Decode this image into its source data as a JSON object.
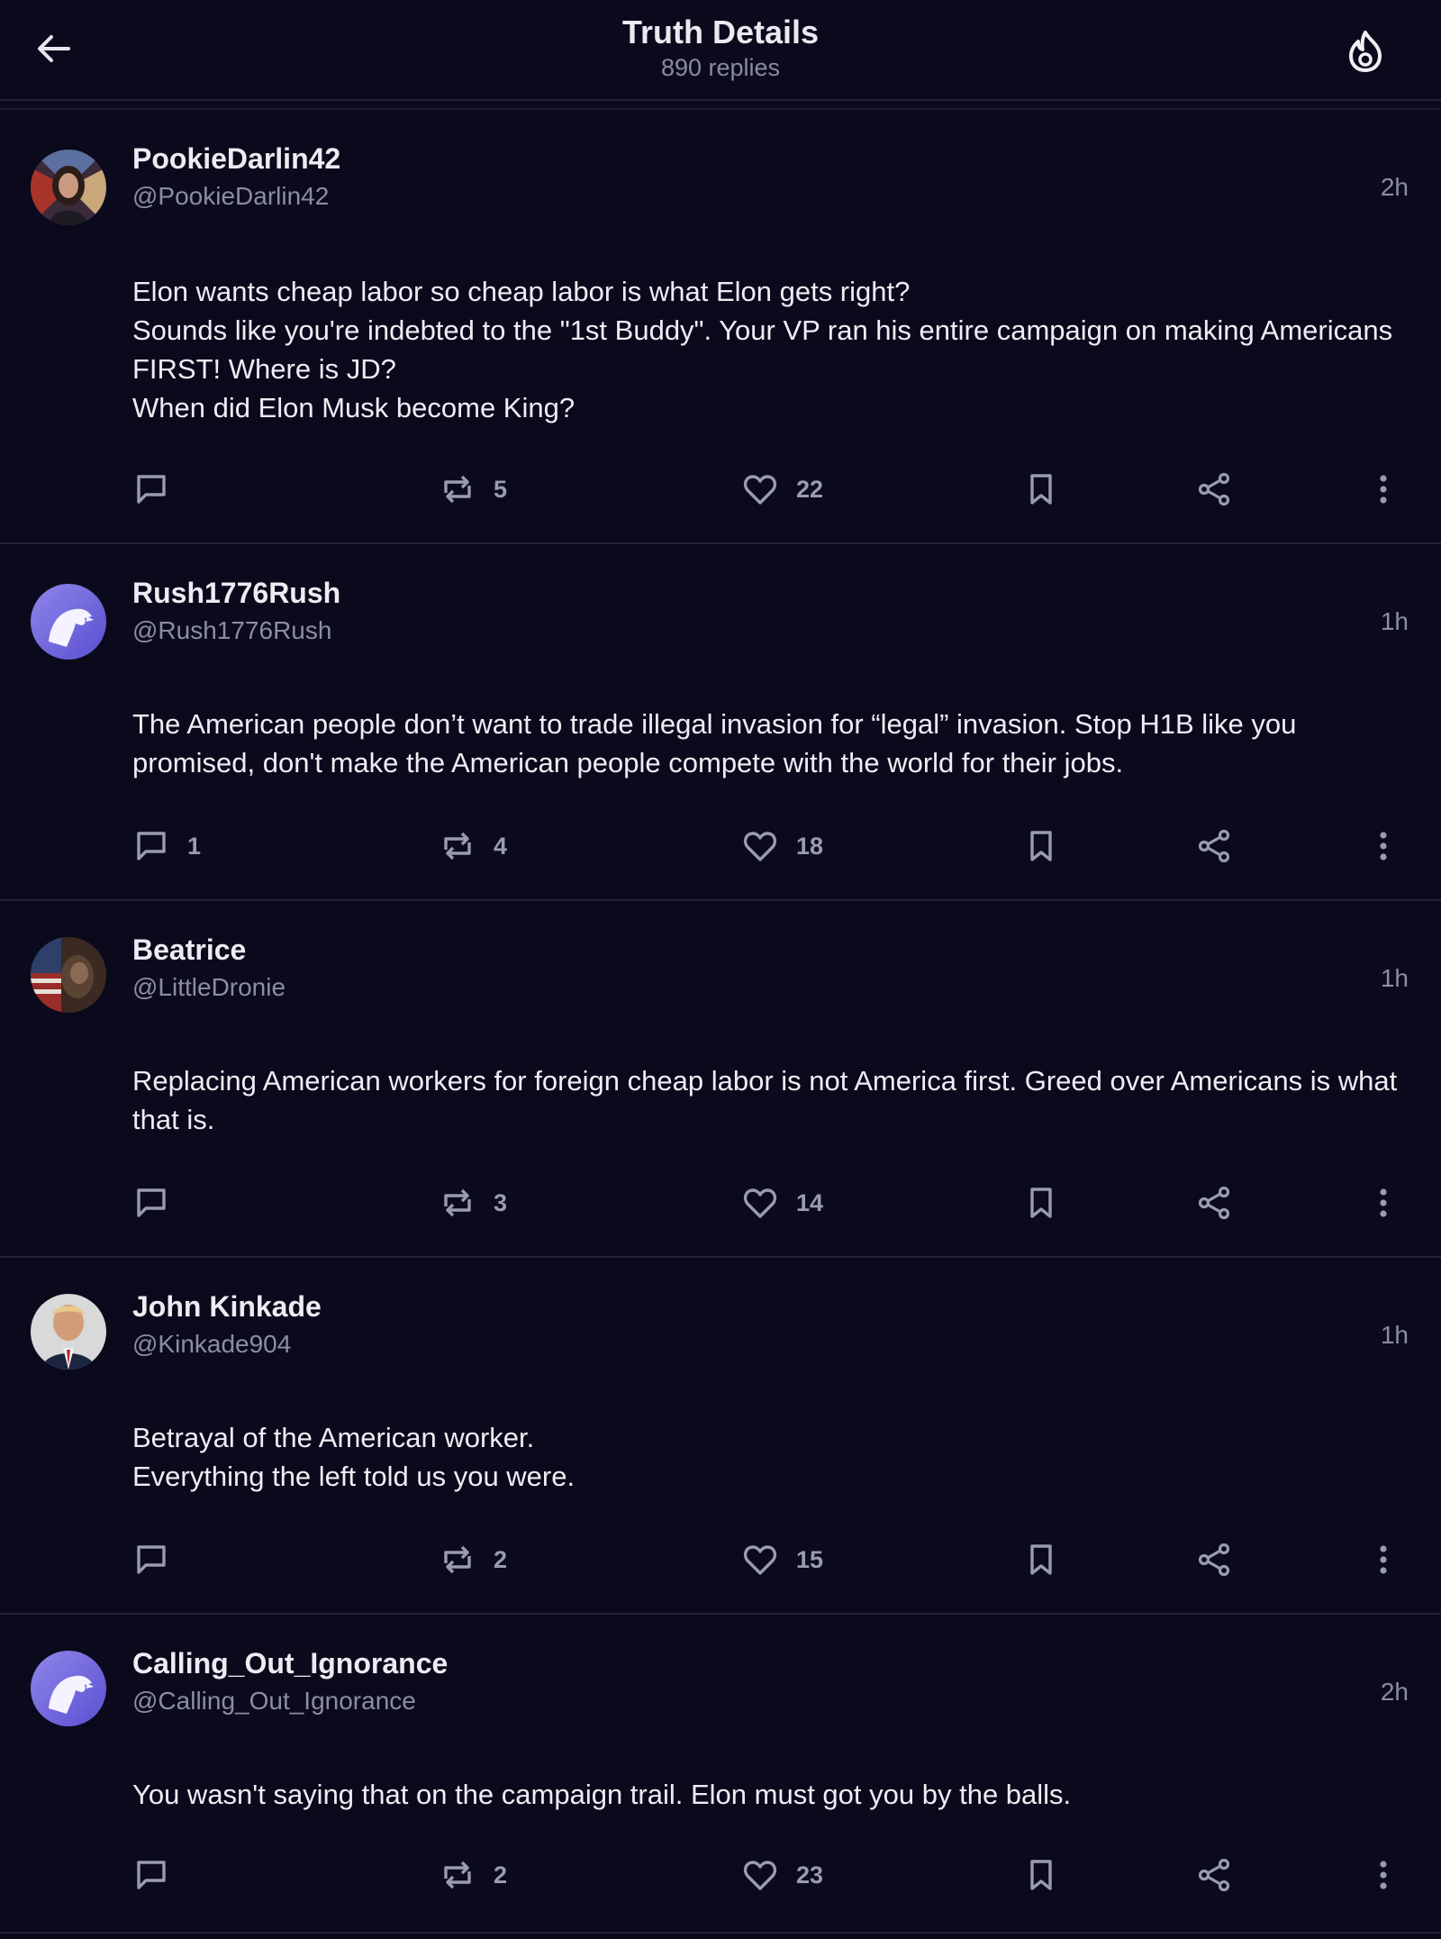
{
  "header": {
    "title": "Truth Details",
    "subtitle": "890 replies"
  },
  "posts": [
    {
      "display_name": "PookieDarlin42",
      "handle": "@PookieDarlin42",
      "time": "2h",
      "body": "Elon wants cheap labor so cheap labor is what Elon gets right?\nSounds like you're indebted to the \"1st Buddy\". Your VP ran his entire campaign on making Americans FIRST! Where is JD?\nWhen did Elon Musk become King?",
      "replies": "",
      "retruths": "5",
      "likes": "22"
    },
    {
      "display_name": "Rush1776Rush",
      "handle": "@Rush1776Rush",
      "time": "1h",
      "body": "The American people don’t want to trade illegal invasion for “legal” invasion. Stop H1B like you promised, don't make the American people compete with the world for their jobs.",
      "replies": "1",
      "retruths": "4",
      "likes": "18"
    },
    {
      "display_name": "Beatrice",
      "handle": "@LittleDronie",
      "time": "1h",
      "body": "Replacing American workers for foreign cheap labor is not America first. Greed over Americans is what that is.",
      "replies": "",
      "retruths": "3",
      "likes": "14"
    },
    {
      "display_name": "John Kinkade",
      "handle": "@Kinkade904",
      "time": "1h",
      "body": "Betrayal of the American worker.\nEverything the left told us you were.",
      "replies": "",
      "retruths": "2",
      "likes": "15"
    },
    {
      "display_name": "Calling_Out_Ignorance",
      "handle": "@Calling_Out_Ignorance",
      "time": "2h",
      "body": "You wasn't saying that on the campaign trail. Elon must got you by the balls.",
      "replies": "",
      "retruths": "2",
      "likes": "23"
    }
  ],
  "icons": {
    "back": "arrow-left-icon",
    "header_right": "fire-icon",
    "reply": "speech-bubble-icon",
    "retruth": "repost-arrows-icon",
    "like": "heart-icon",
    "bookmark": "bookmark-icon",
    "share": "share-icon",
    "more": "vertical-ellipsis-icon"
  },
  "colors": {
    "background": "#0b0a1c",
    "divider": "#23223a",
    "muted_text": "#8c8ca2",
    "primary_text": "#ececf2"
  }
}
